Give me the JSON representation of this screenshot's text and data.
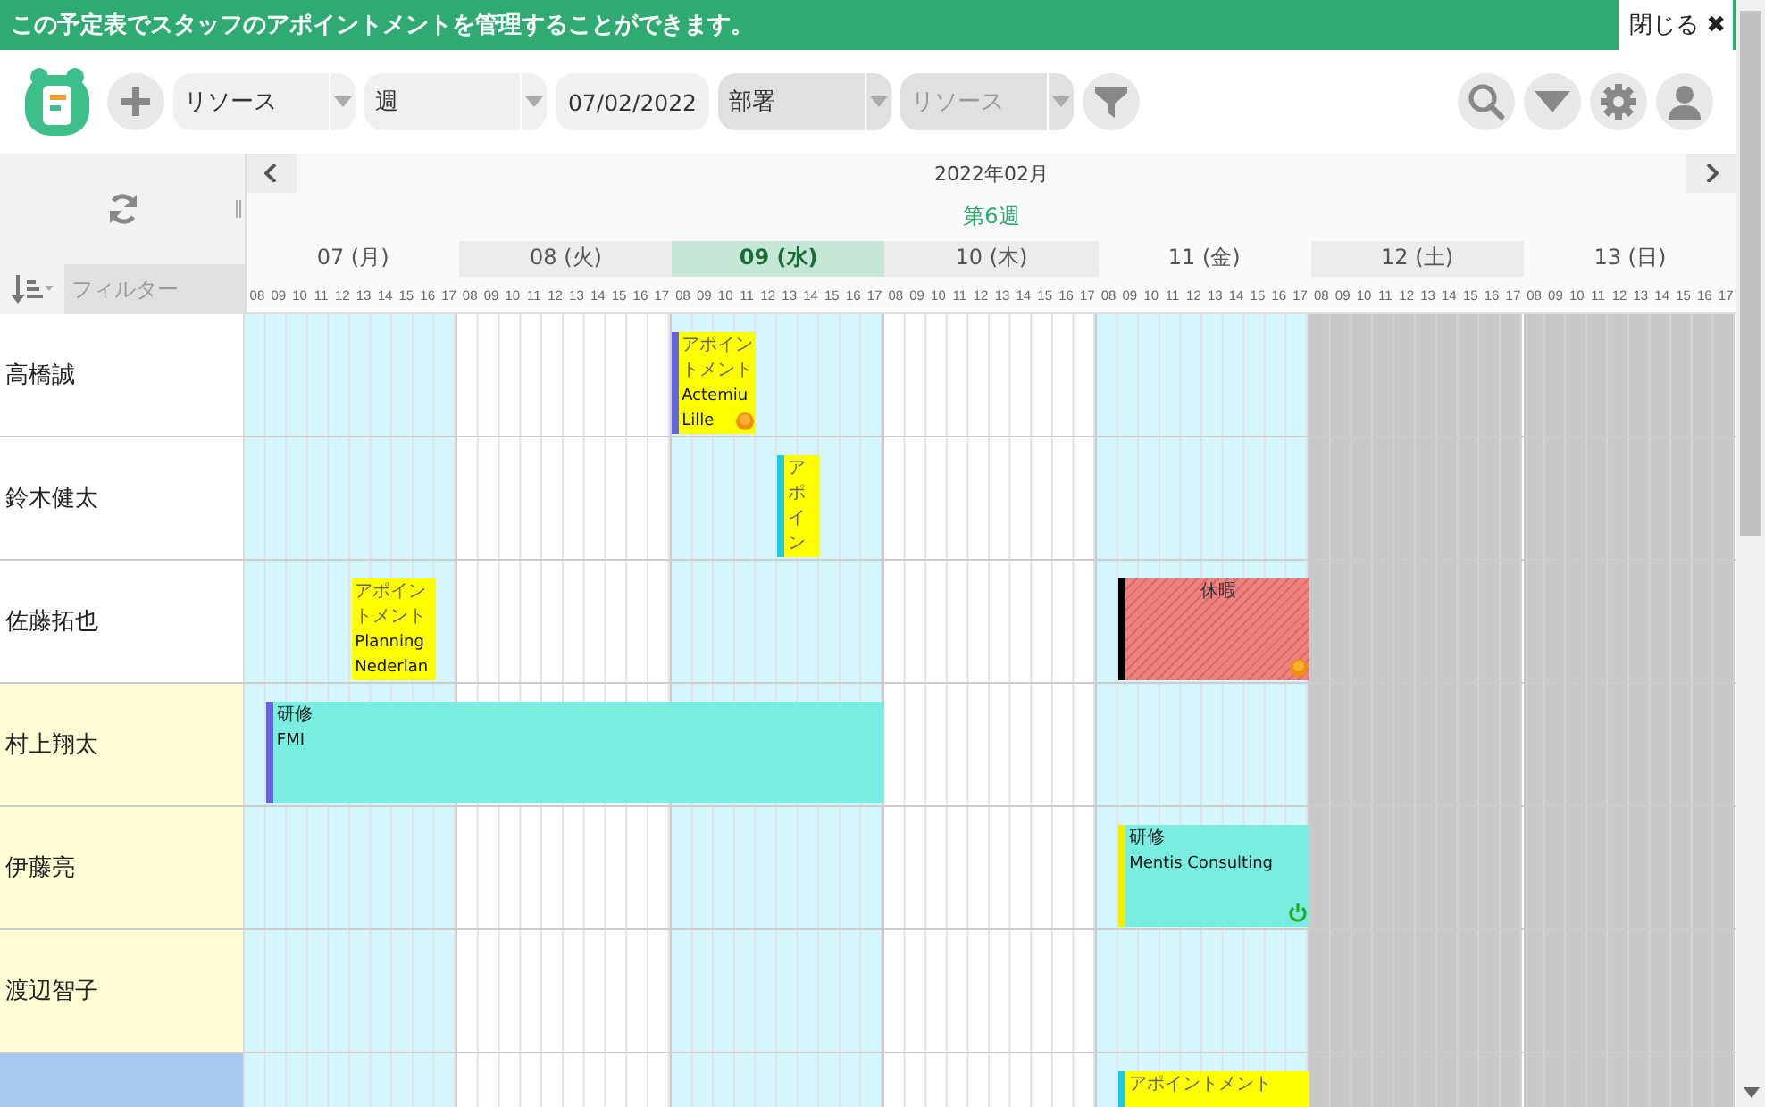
{
  "banner": {
    "message": "この予定表でスタッフのアポイントメントを管理することができます。",
    "close_label": "閉じる",
    "close_icon": "✖"
  },
  "toolbar": [
    {
      "kind": "select",
      "value": "リソース"
    },
    {
      "kind": "select",
      "value": "週"
    },
    {
      "kind": "date",
      "value": "07/02/2022"
    },
    {
      "kind": "filter",
      "value": "部署"
    },
    {
      "kind": "filter",
      "placeholder": "リソース"
    }
  ],
  "filter_field": {
    "placeholder": "フィルター"
  },
  "calendar": {
    "month": "2022年02月",
    "week": "第6週",
    "days": [
      {
        "label": "07 (月)",
        "kind": "weekday",
        "selected": false,
        "hours": [
          "08",
          "09",
          "10",
          "11",
          "12",
          "13",
          "14",
          "15",
          "16",
          "17"
        ]
      },
      {
        "label": "08 (火)",
        "kind": "weekday",
        "selected": false,
        "hours": [
          "08",
          "09",
          "10",
          "11",
          "12",
          "13",
          "14",
          "15",
          "16",
          "17"
        ]
      },
      {
        "label": "09 (水)",
        "kind": "weekday",
        "selected": true,
        "hours": [
          "08",
          "09",
          "10",
          "11",
          "12",
          "13",
          "14",
          "15",
          "16",
          "17"
        ]
      },
      {
        "label": "10 (木)",
        "kind": "weekday",
        "selected": false,
        "hours": [
          "08",
          "09",
          "10",
          "11",
          "12",
          "13",
          "14",
          "15",
          "16",
          "17"
        ]
      },
      {
        "label": "11 (金)",
        "kind": "weekday",
        "selected": false,
        "hours": [
          "08",
          "09",
          "10",
          "11",
          "12",
          "13",
          "14",
          "15",
          "16",
          "17"
        ]
      },
      {
        "label": "12 (土)",
        "kind": "weekend",
        "selected": false,
        "hours": [
          "08",
          "09",
          "10",
          "11",
          "12",
          "13",
          "14",
          "15",
          "16",
          "17"
        ]
      },
      {
        "label": "13 (日)",
        "kind": "weekend",
        "selected": false,
        "hours": [
          "08",
          "09",
          "10",
          "11",
          "12",
          "13",
          "14",
          "15",
          "16",
          "17"
        ]
      }
    ]
  },
  "resources": [
    {
      "name": "高橋誠",
      "color": "#ffffff",
      "events": [
        {
          "kind": "appointment",
          "title": "アポイントメント",
          "client": [
            "Actemiu",
            "Lille"
          ],
          "color": "#6464e0",
          "pending": true
        }
      ]
    },
    {
      "name": "鈴木健太",
      "color": "#ffffff",
      "events": [
        {
          "kind": "appointment",
          "title": "アポイン",
          "color": "#20c8e0"
        }
      ]
    },
    {
      "name": "佐藤拓也",
      "color": "#ffffff",
      "events": [
        {
          "kind": "appointment",
          "title": "アポイントメント",
          "client": [
            "Planning",
            "Nederlan"
          ]
        },
        {
          "kind": "vacation",
          "title": "休暇",
          "color": "#000000",
          "pending": true
        }
      ]
    },
    {
      "name": "村上翔太",
      "color": "#fffdd6",
      "events": [
        {
          "kind": "training",
          "title": "研修",
          "client": [
            "FMI"
          ],
          "color": "#6464e0"
        }
      ]
    },
    {
      "name": "伊藤亮",
      "color": "#fffdd6",
      "events": [
        {
          "kind": "training",
          "title": "研修",
          "client": [
            "Mentis Consulting"
          ],
          "color": "#f0f000",
          "active": true
        }
      ]
    },
    {
      "name": "渡辺智子",
      "color": "#fffdd6"
    },
    {
      "color": "#a8c8f0",
      "events": [
        {
          "kind": "appointment",
          "title": "アポイントメント",
          "color": "#20c8e0"
        }
      ]
    }
  ]
}
